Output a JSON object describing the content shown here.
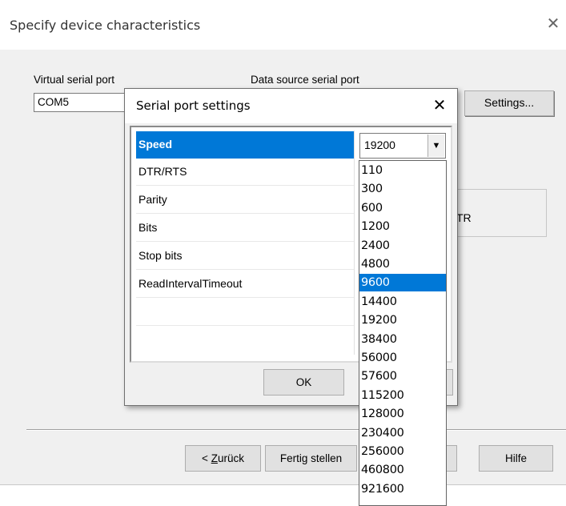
{
  "outer_dialog": {
    "title": "Specify device characteristics",
    "close_glyph": "✕",
    "virtual_serial_port_label": "Virtual serial port",
    "virtual_serial_port_value": "COM5",
    "data_source_label": "Data source serial port",
    "settings_button": "Settings...",
    "partial_label": "TR",
    "back_button_prefix": "< ",
    "back_button_mnemonic": "Z",
    "back_button_rest": "urück",
    "finish_button": "Fertig stellen",
    "help_button": "Hilfe"
  },
  "serial_dialog": {
    "title": "Serial port settings",
    "close_glyph": "✕",
    "properties": [
      "Speed",
      "DTR/RTS",
      "Parity",
      "Bits",
      "Stop bits",
      "ReadIntervalTimeout"
    ],
    "selected_property": "Speed",
    "speed_value": "19200",
    "ok_button": "OK"
  },
  "speed_dropdown": {
    "options": [
      "110",
      "300",
      "600",
      "1200",
      "2400",
      "4800",
      "9600",
      "14400",
      "19200",
      "38400",
      "56000",
      "57600",
      "115200",
      "128000",
      "230400",
      "256000",
      "460800",
      "921600"
    ],
    "highlighted": "9600"
  },
  "colors": {
    "selection": "#0078d7",
    "dialog_bg": "#f0f0f0",
    "title_bg": "#ffffff"
  },
  "icons": {
    "close": "close-icon",
    "dropdown": "chevron-down-icon"
  }
}
